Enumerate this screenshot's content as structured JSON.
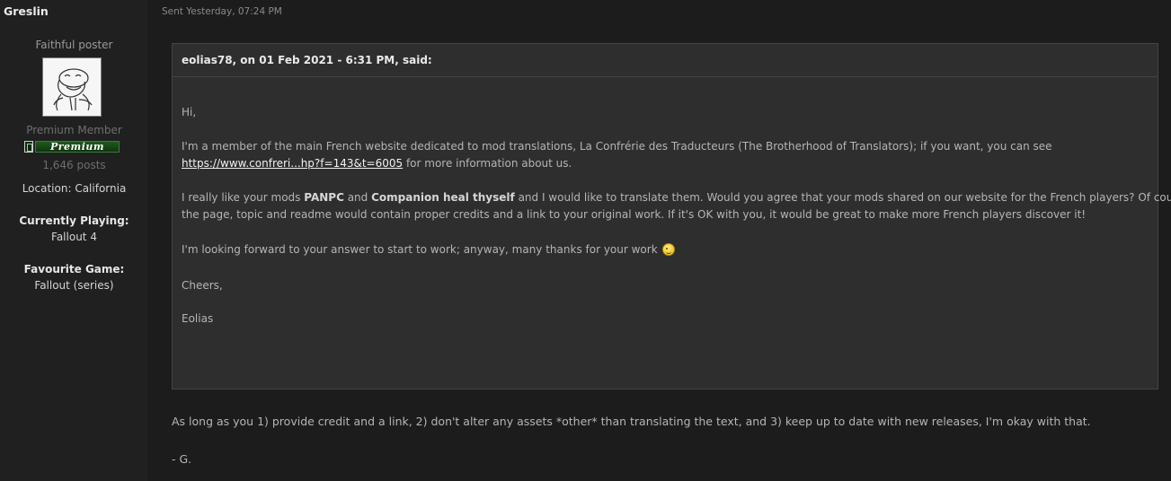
{
  "author": {
    "name": "Greslin",
    "title": "Faithful poster",
    "group": "Premium Member",
    "badge": "Premium",
    "posts": "1,646 posts",
    "location": "Location: California",
    "currently_playing_label": "Currently Playing:",
    "currently_playing": "Fallout 4",
    "favourite_game_label": "Favourite Game:",
    "favourite_game": "Fallout (series)"
  },
  "post": {
    "sent": "Sent Yesterday, 07:24 PM",
    "quote": {
      "header": "eolias78, on 01 Feb 2021 - 6:31 PM, said:",
      "greeting": "Hi,",
      "p1": "I'm a member of the main French website dedicated to mod translations, La Confrérie des Traducteurs (The Brotherhood of Translators); if you want, you can see",
      "p1_link": "https://www.confreri...hp?f=143&t=6005",
      "p1_after": " for more information about us.",
      "p2_a": "I really like your mods ",
      "p2_mod1": "PANPC",
      "p2_b": " and ",
      "p2_mod2": "Companion heal thyself",
      "p2_c": " and I would like to translate them. Would you agree that your mods  shared on our website for the French players? Of course",
      "p2_line2": "the page, topic and readme would contain proper credits and a link to your original work. If it's OK with you, it would be great to make more French players discover it!",
      "p3": "I'm looking forward to your answer to start to work; anyway, many thanks for your work ",
      "closing": "Cheers,",
      "signature": "Eolias"
    },
    "reply": "As long as you 1) provide credit and a link, 2) don't alter any assets *other* than translating the text, and 3) keep up to date with new releases, I'm okay with that.",
    "reply_sign": "- G."
  }
}
